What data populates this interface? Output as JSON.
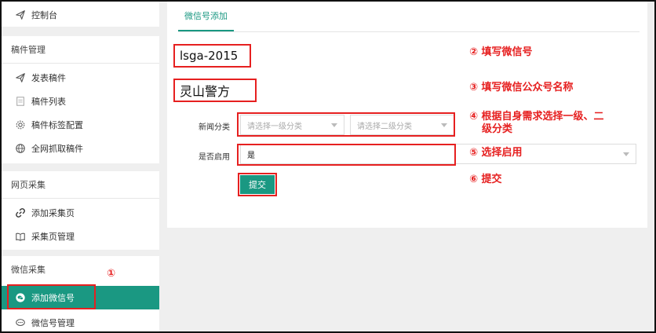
{
  "sidebar": {
    "top_item": {
      "label": "控制台",
      "icon": "send-icon"
    },
    "sections": [
      {
        "title": "稿件管理",
        "items": [
          {
            "label": "发表稿件",
            "icon": "send-icon"
          },
          {
            "label": "稿件列表",
            "icon": "document-icon"
          },
          {
            "label": "稿件标签配置",
            "icon": "gear-icon"
          },
          {
            "label": "全网抓取稿件",
            "icon": "globe-icon"
          }
        ]
      },
      {
        "title": "网页采集",
        "items": [
          {
            "label": "添加采集页",
            "icon": "link-icon"
          },
          {
            "label": "采集页管理",
            "icon": "book-icon"
          }
        ]
      },
      {
        "title": "微信采集",
        "items": [
          {
            "label": "添加微信号",
            "icon": "wechat-icon",
            "active": true
          },
          {
            "label": "微信号管理",
            "icon": "chat-icon"
          }
        ]
      }
    ]
  },
  "main": {
    "tab_label": "微信号添加",
    "wechat_id_value": "lsga-2015",
    "account_name_value": "灵山警方",
    "form": {
      "category_label": "新闻分类",
      "category1_placeholder": "请选择一级分类",
      "category2_placeholder": "请选择二级分类",
      "enable_label": "是否启用",
      "enable_value": "是",
      "submit_label": "提交"
    }
  },
  "annotations": {
    "step1": "①",
    "step2": "② 填写微信号",
    "step3": "③ 填写微信公众号名称",
    "step4_line1": "④ 根据自身需求选择一级、二",
    "step4_line2": "级分类",
    "step5": "⑤ 选择启用",
    "step6": "⑥ 提交"
  },
  "colors": {
    "accent": "#1a9882",
    "annotation_red": "#e62020"
  }
}
